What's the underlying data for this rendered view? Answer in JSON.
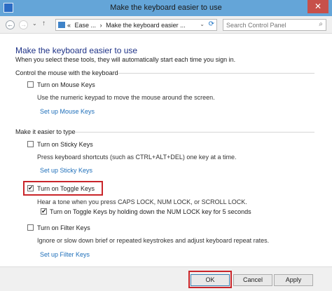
{
  "window": {
    "title": "Make the keyboard easier to use",
    "close": "✕"
  },
  "nav": {
    "back": "←",
    "forward": "→",
    "recent": "⌄",
    "up": "↑",
    "breadcrumb_chevrons": "«",
    "crumb1": "Ease ...",
    "crumb_sep": "›",
    "crumb2": "Make the keyboard easier ...",
    "dropdown": "⌄",
    "refresh": "⟳"
  },
  "search": {
    "placeholder": "Search Control Panel",
    "icon": "⌕"
  },
  "page": {
    "heading": "Make the keyboard easier to use",
    "intro": "When you select these tools, they will automatically start each time you sign in."
  },
  "mouse_section": {
    "title": "Control the mouse with the keyboard",
    "mouse_keys": {
      "label": "Turn on Mouse Keys",
      "checked": false,
      "desc": "Use the numeric keypad to move the mouse around the screen.",
      "link": "Set up Mouse Keys"
    }
  },
  "typing_section": {
    "title": "Make it easier to type",
    "sticky_keys": {
      "label": "Turn on Sticky Keys",
      "checked": false,
      "desc": "Press keyboard shortcuts (such as CTRL+ALT+DEL) one key at a time.",
      "link": "Set up Sticky Keys"
    },
    "toggle_keys": {
      "label": "Turn on Toggle Keys",
      "checked": true,
      "desc": "Hear a tone when you press CAPS LOCK, NUM LOCK, or SCROLL LOCK.",
      "sub_label": "Turn on Toggle Keys by holding down the NUM LOCK key for 5 seconds",
      "sub_checked": true
    },
    "filter_keys": {
      "label": "Turn on Filter Keys",
      "checked": false,
      "desc": "Ignore or slow down brief or repeated keystrokes and adjust keyboard repeat rates.",
      "link": "Set up Filter Keys"
    }
  },
  "checkmark": "✔",
  "buttons": {
    "ok": "OK",
    "cancel": "Cancel",
    "apply": "Apply"
  },
  "colors": {
    "titlebar": "#64a5d8",
    "close": "#c7504a",
    "link": "#1e6fba",
    "heading": "#1e3287",
    "highlight": "#c9252a"
  }
}
